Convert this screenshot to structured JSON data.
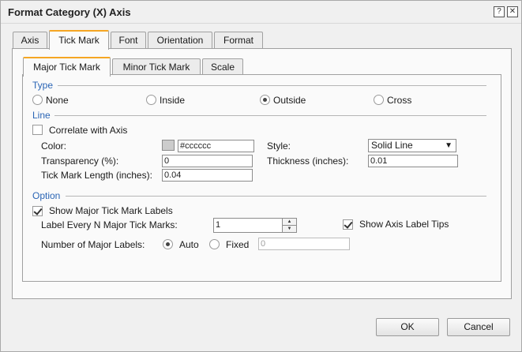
{
  "dialog": {
    "title": "Format Category (X) Axis",
    "help_glyph": "?",
    "close_glyph": "✕"
  },
  "tabs": [
    "Axis",
    "Tick Mark",
    "Font",
    "Orientation",
    "Format"
  ],
  "active_tab": "Tick Mark",
  "subtabs": [
    "Major Tick Mark",
    "Minor Tick Mark",
    "Scale"
  ],
  "active_subtab": "Major Tick Mark",
  "type_section": {
    "label": "Type",
    "options": [
      "None",
      "Inside",
      "Outside",
      "Cross"
    ],
    "selected": "Outside"
  },
  "line_section": {
    "label": "Line",
    "correlate_label": "Correlate with Axis",
    "correlate_checked": false,
    "color_label": "Color:",
    "color_value": "#cccccc",
    "color_swatch": "#cccccc",
    "style_label": "Style:",
    "style_value": "Solid Line",
    "transparency_label": "Transparency (%):",
    "transparency_value": "0",
    "thickness_label": "Thickness (inches):",
    "thickness_value": "0.01",
    "length_label": "Tick Mark Length (inches):",
    "length_value": "0.04"
  },
  "option_section": {
    "label": "Option",
    "show_labels_label": "Show Major Tick Mark Labels",
    "show_labels_checked": true,
    "label_every_label": "Label Every N Major Tick Marks:",
    "label_every_value": "1",
    "show_tips_label": "Show Axis Label Tips",
    "show_tips_checked": true,
    "num_labels_label": "Number of Major Labels:",
    "auto_label": "Auto",
    "fixed_label": "Fixed",
    "num_labels_mode": "Auto",
    "fixed_value": "0"
  },
  "buttons": {
    "ok": "OK",
    "cancel": "Cancel"
  },
  "colors": {
    "accent_tab": "#f5a623",
    "section_label": "#2a65b5"
  }
}
